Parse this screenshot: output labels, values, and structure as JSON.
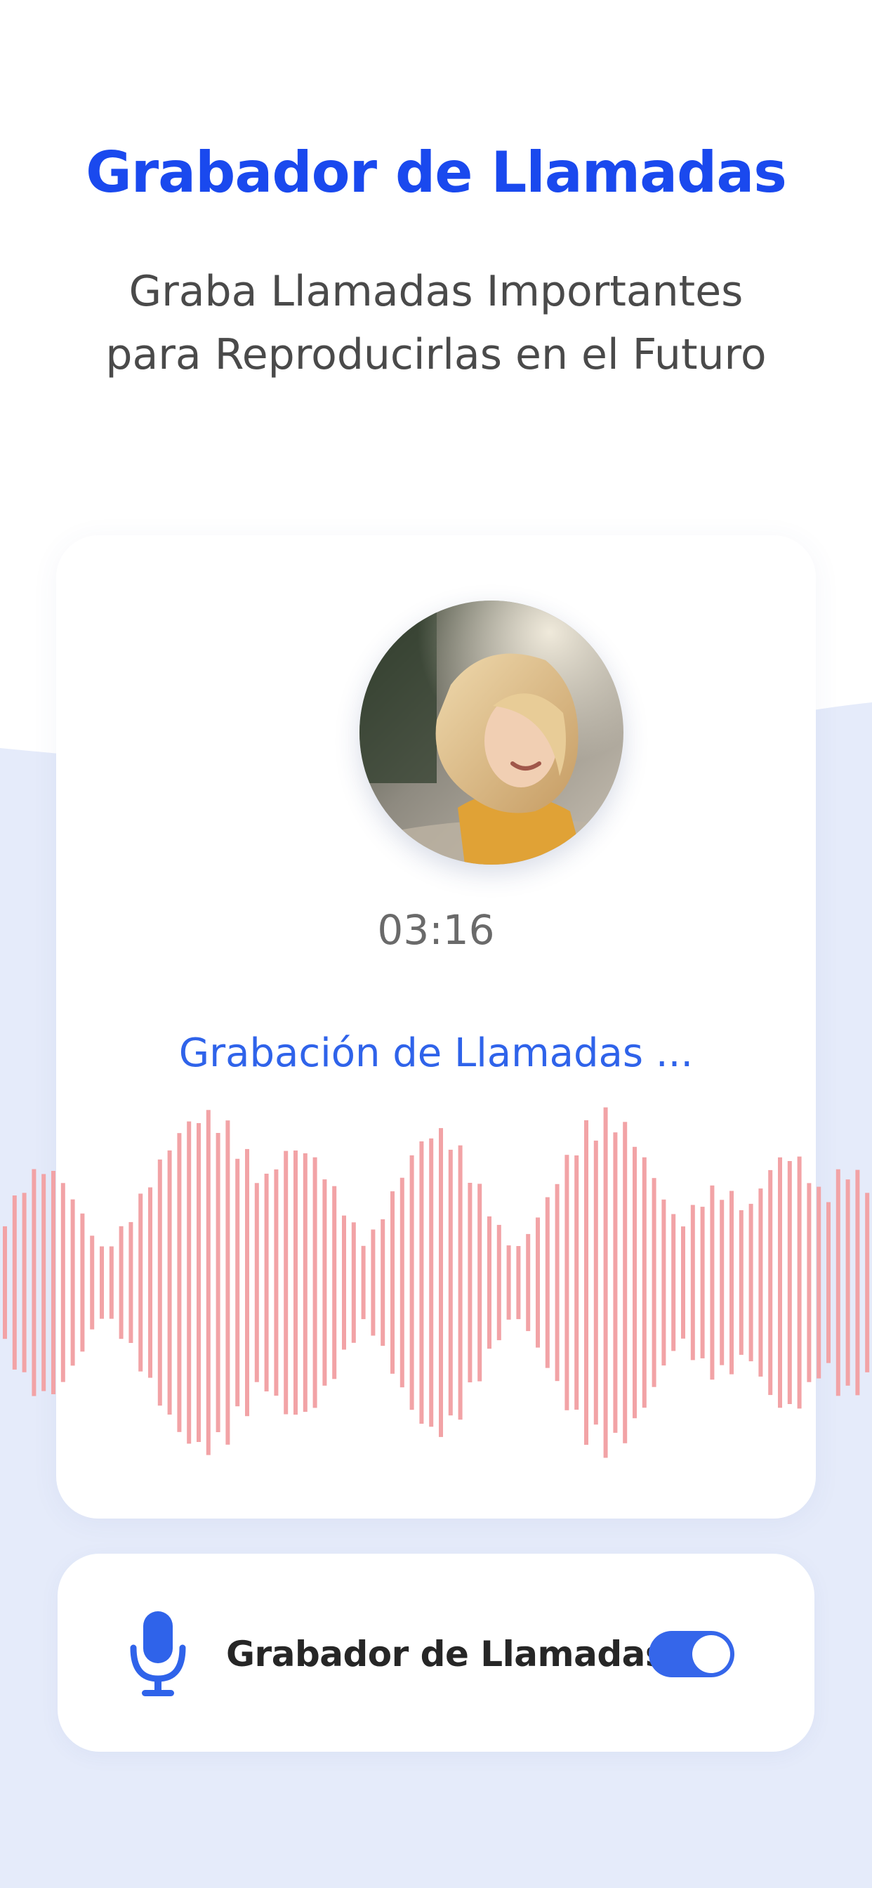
{
  "header": {
    "title": "Grabador de Llamadas",
    "subtitle_line1": "Graba Llamadas Importantes",
    "subtitle_line2": "para Reproducirlas en el Futuro"
  },
  "recording_card": {
    "avatar_icon": "contact-photo",
    "timer": "03:16",
    "status": "Grabación de Llamadas ..."
  },
  "toggle_card": {
    "icon": "microphone-icon",
    "label": "Grabador de Llamadas",
    "enabled": true
  },
  "colors": {
    "accent": "#1a49ee",
    "link_blue": "#2f63ea",
    "toggle_on": "#3566ea",
    "waveform": "#f2a3a6",
    "background_tint": "#e5ebfa"
  }
}
